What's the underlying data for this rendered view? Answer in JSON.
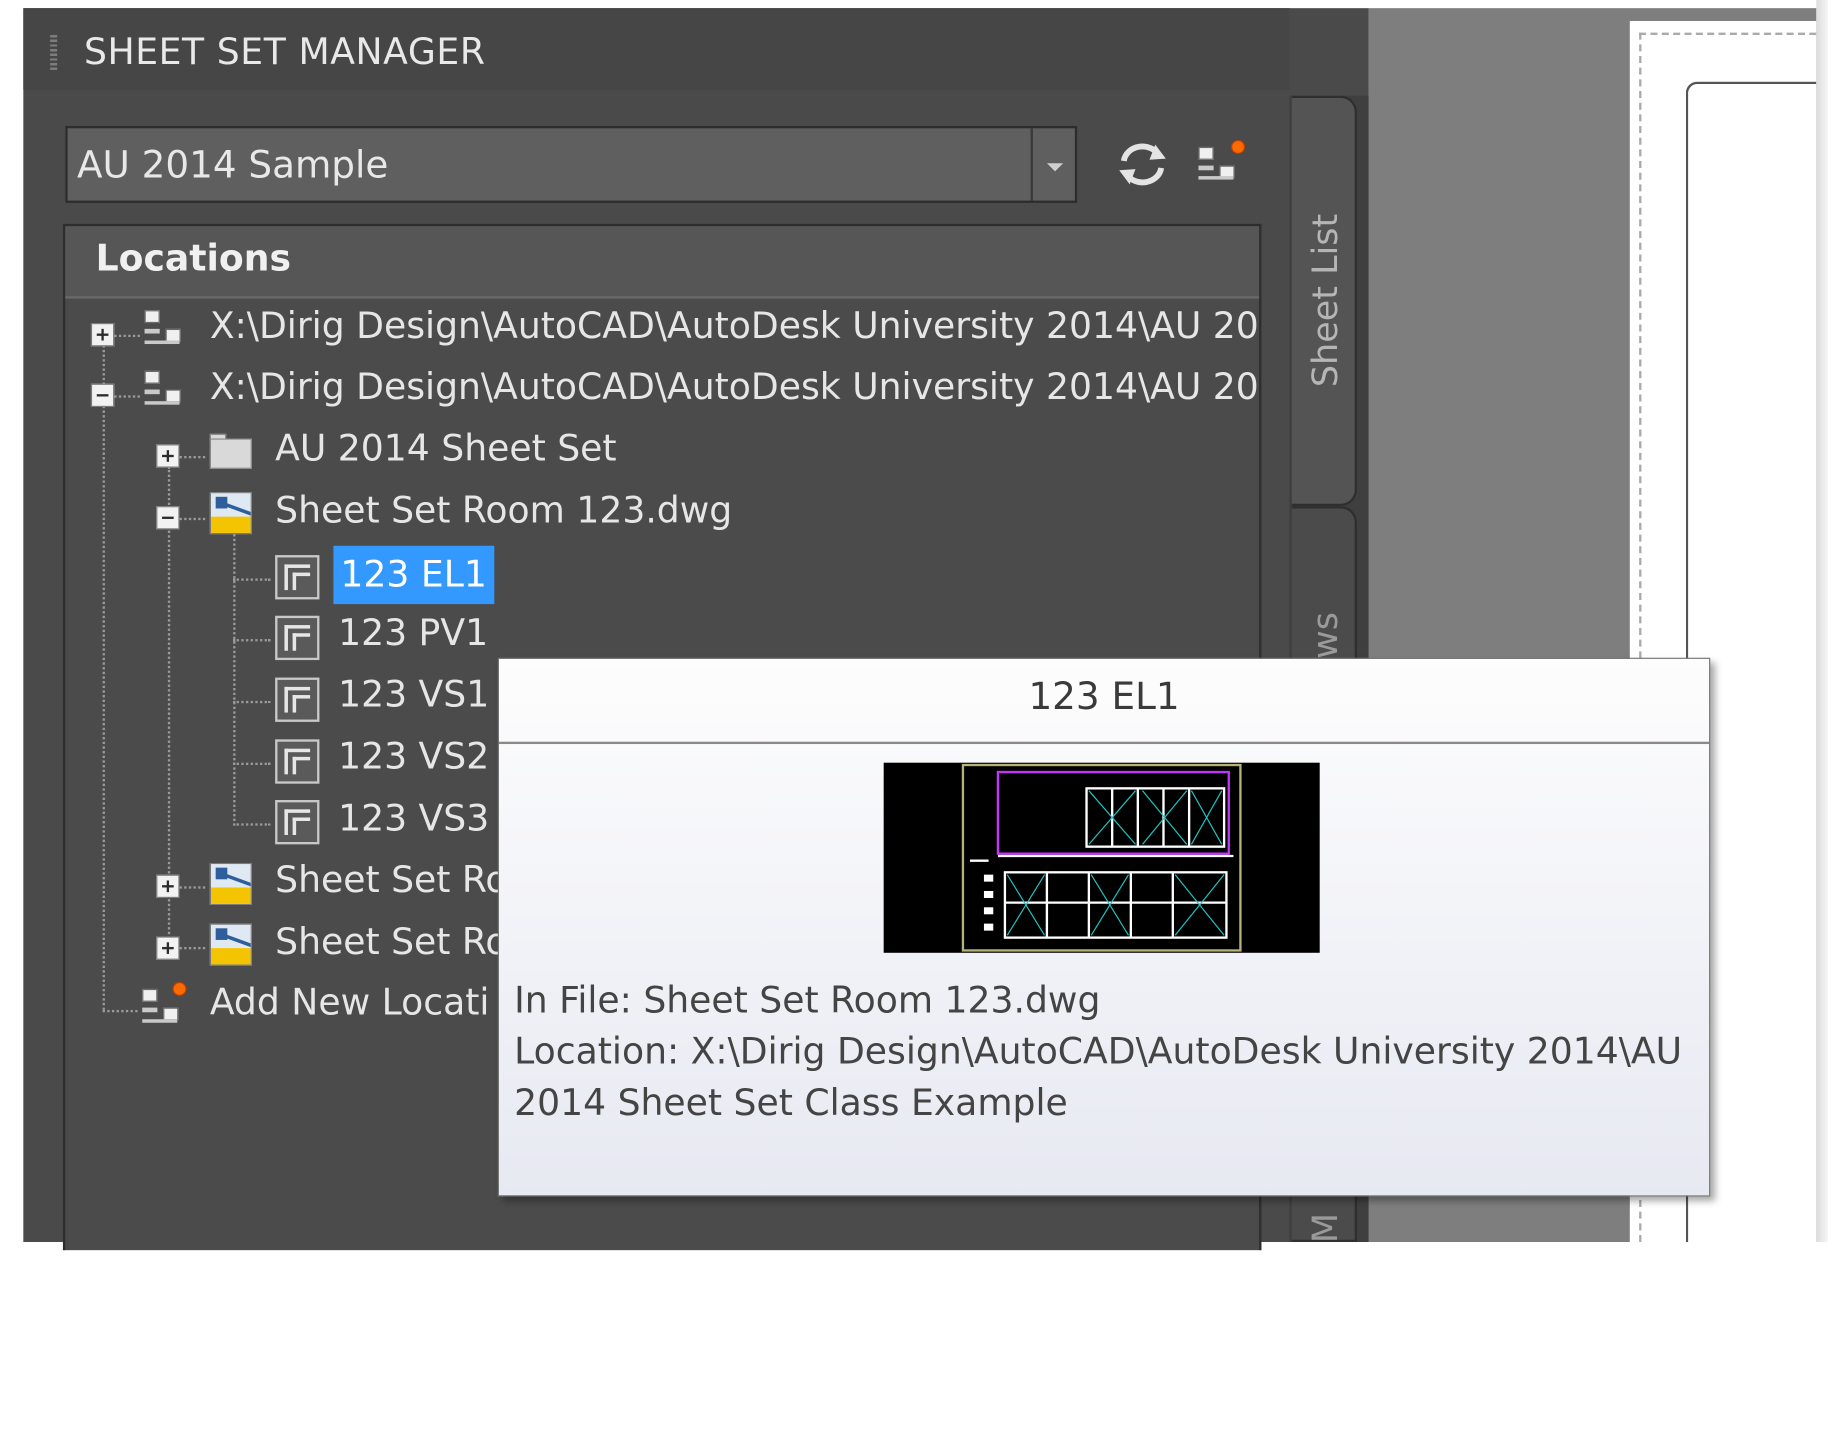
{
  "panel": {
    "title": "SHEET SET MANAGER",
    "sheet_set_selector": {
      "value": "AU 2014 Sample"
    },
    "toolbar": {
      "refresh_icon": "refresh-icon",
      "model_view_icon": "add-location-icon"
    },
    "locations_header": "Locations"
  },
  "tree": {
    "loc1": "X:\\Dirig Design\\AutoCAD\\AutoDesk University 2014\\AU 20",
    "loc2": "X:\\Dirig Design\\AutoCAD\\AutoDesk University 2014\\AU 20",
    "folder": "AU 2014 Sheet Set",
    "drawing": "Sheet Set Room 123.dwg",
    "views": [
      "123 EL1",
      "123 PV1",
      "123 VS1",
      "123 VS2",
      "123 VS3"
    ],
    "drawing2": "Sheet Set Ro",
    "drawing3": "Sheet Set Ro",
    "add_location": "Add New Locati"
  },
  "side_tabs": {
    "tab1": "Sheet List",
    "tab2": "ws",
    "tab3": "M"
  },
  "tooltip": {
    "title": "123 EL1",
    "in_file": "In File: Sheet Set Room 123.dwg",
    "location_line1": "Location: X:\\Dirig Design\\AutoCAD\\AutoDesk University 2014\\AU",
    "location_line2": "2014 Sheet Set Class Example"
  },
  "colors": {
    "selection": "#3399ff",
    "panel_bg": "#4a4a4a",
    "folder_yellow": "#f5c400"
  }
}
